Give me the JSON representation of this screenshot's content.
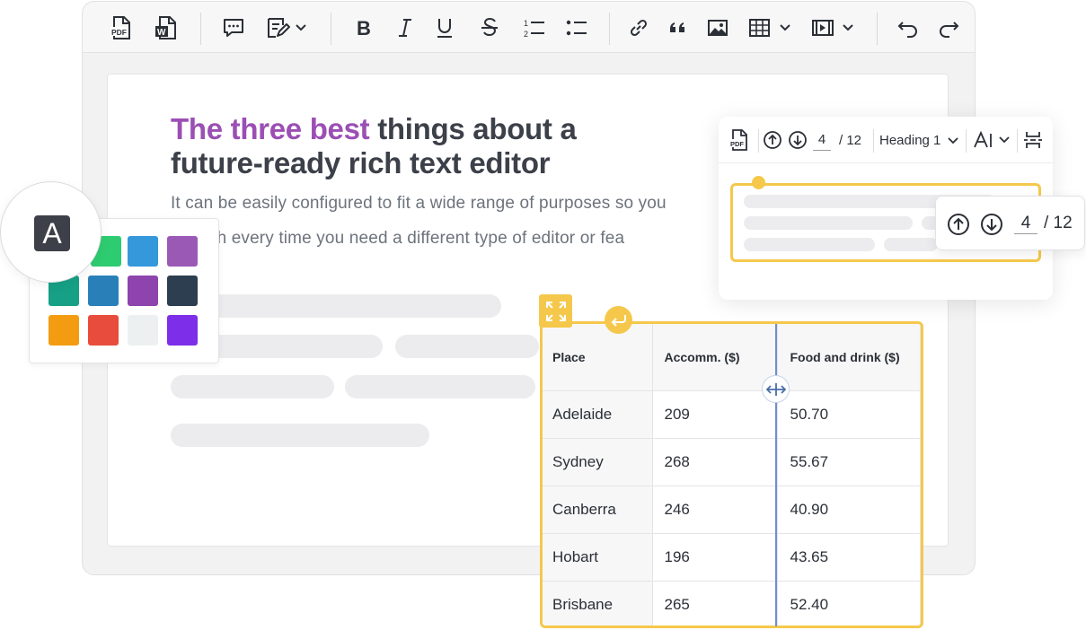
{
  "heading": {
    "accent": "The three best",
    "line1_rest": " things about a",
    "line2": " future-ready rich text editor"
  },
  "body": {
    "line1": "It can be easily configured to fit a wide range of purposes so you",
    "line2": "scratch every time you need a different type of editor or fea"
  },
  "toolbar": {
    "icons": [
      "pdf-export-icon",
      "word-export-icon",
      "comment-icon",
      "track-changes-icon",
      "bold-icon",
      "italic-icon",
      "underline-icon",
      "strikethrough-icon",
      "numbered-list-icon",
      "bulleted-list-icon",
      "link-icon",
      "blockquote-icon",
      "image-icon",
      "table-icon",
      "media-icon",
      "undo-icon",
      "redo-icon"
    ]
  },
  "font_badge": "A",
  "palette": {
    "colors": [
      "#2ecc71",
      "#3498db",
      "#9b59b6",
      "#16a085",
      "#2980b9",
      "#8e44ad",
      "#2c3e50",
      "#f39c12",
      "#e74c3c",
      "#ecf0f1",
      "#7d2ee8"
    ]
  },
  "float_panel": {
    "page_value": "4",
    "page_total": "/ 12",
    "heading_select": "Heading 1"
  },
  "nav_popup": {
    "page_value": "4",
    "page_total": "/ 12"
  },
  "table": {
    "headers": [
      "Place",
      "Accomm. ($)",
      "Food and drink ($)"
    ],
    "rows": [
      [
        "Adelaide",
        "209",
        "50.70"
      ],
      [
        "Sydney",
        "268",
        "55.67"
      ],
      [
        "Canberra",
        "246",
        "40.90"
      ],
      [
        "Hobart",
        "196",
        "43.65"
      ],
      [
        "Brisbane",
        "265",
        "52.40"
      ]
    ]
  },
  "colors": {
    "accent_purple": "#9b4fb4",
    "highlight_yellow": "#f5c84c",
    "resizer_blue": "#6e8fcb"
  }
}
